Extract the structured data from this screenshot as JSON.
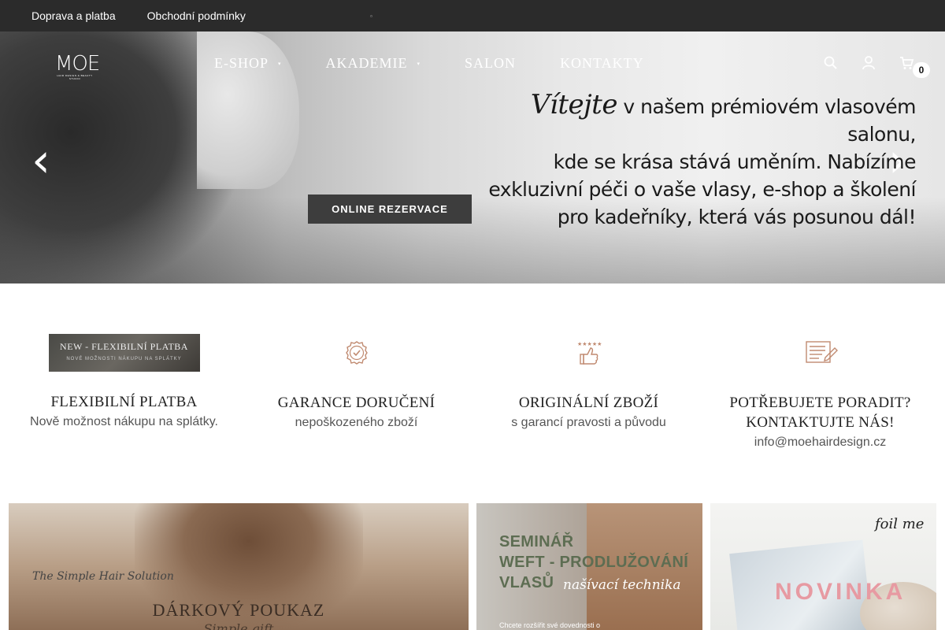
{
  "topbar": {
    "links": [
      "Doprava a platba",
      "Obchodní podmínky"
    ],
    "tiny": "▫"
  },
  "header": {
    "logo_text": "MOE",
    "logo_sub": "HAIR DESIGN & BEAUTY STUDIO",
    "nav": [
      {
        "label": "E-SHOP",
        "caret": "▾"
      },
      {
        "label": "AKADEMIE",
        "caret": "▾"
      },
      {
        "label": "SALON"
      },
      {
        "label": "KONTAKTY"
      }
    ],
    "icons": {
      "search": "⚲",
      "account": "👤",
      "cart": "🛒"
    },
    "cart_count": "0"
  },
  "hero": {
    "prev_arrow": "‹",
    "next_arrow": "›",
    "headline_script": "Vítejte",
    "headline_line1": " v našem prémiovém vlasovém salonu,",
    "headline_line2": "kde se krása stává uměním. Nabízíme",
    "headline_line3": "exkluzivní péči o vaše vlasy, e-shop a školení",
    "headline_line4": "pro kadeřníky, která vás posunou dál!",
    "cta": "ONLINE REZERVACE"
  },
  "features": [
    {
      "banner_l1": "NEW - FLEXIBILNÍ PLATBA",
      "banner_l2": "NOVÉ MOŽNOSTI NÁKUPU NA SPLÁTKY",
      "title": "FLEXIBILNÍ PLATBA",
      "desc": "Nově možnost nákupu na splátky."
    },
    {
      "icon": "badge-check-icon",
      "title": "GARANCE DORUČENÍ",
      "desc": "nepoškozeného zboží"
    },
    {
      "icon": "thumbs-up-stars-icon",
      "title": "ORIGINÁLNÍ ZBOŽÍ",
      "desc": "s garancí pravosti a původu"
    },
    {
      "icon": "contact-note-icon",
      "title": "POTŘEBUJETE PORADIT?",
      "title2": "KONTAKTUJTE NÁS!",
      "desc": "info@moehairdesign.cz"
    }
  ],
  "cards": {
    "voucher": {
      "script": "The Simple Hair Solution",
      "title": "DÁRKOVÝ POUKAZ",
      "sub": "Simple gift"
    },
    "seminar": {
      "line1": "SEMINÁŘ",
      "line2": "WEFT - PRODLUŽOVÁNÍ",
      "line3": "VLASŮ",
      "script": "našívací technika",
      "small": "Chcete rozšířit své dovednosti o"
    },
    "novinka": {
      "script": "foil me",
      "title": "NOVINKA"
    }
  },
  "colors": {
    "topbar": "#2b2b2b",
    "cta": "#3d3d3d",
    "novinka": "#e79aa2",
    "seminar_text": "#5d6d52"
  }
}
